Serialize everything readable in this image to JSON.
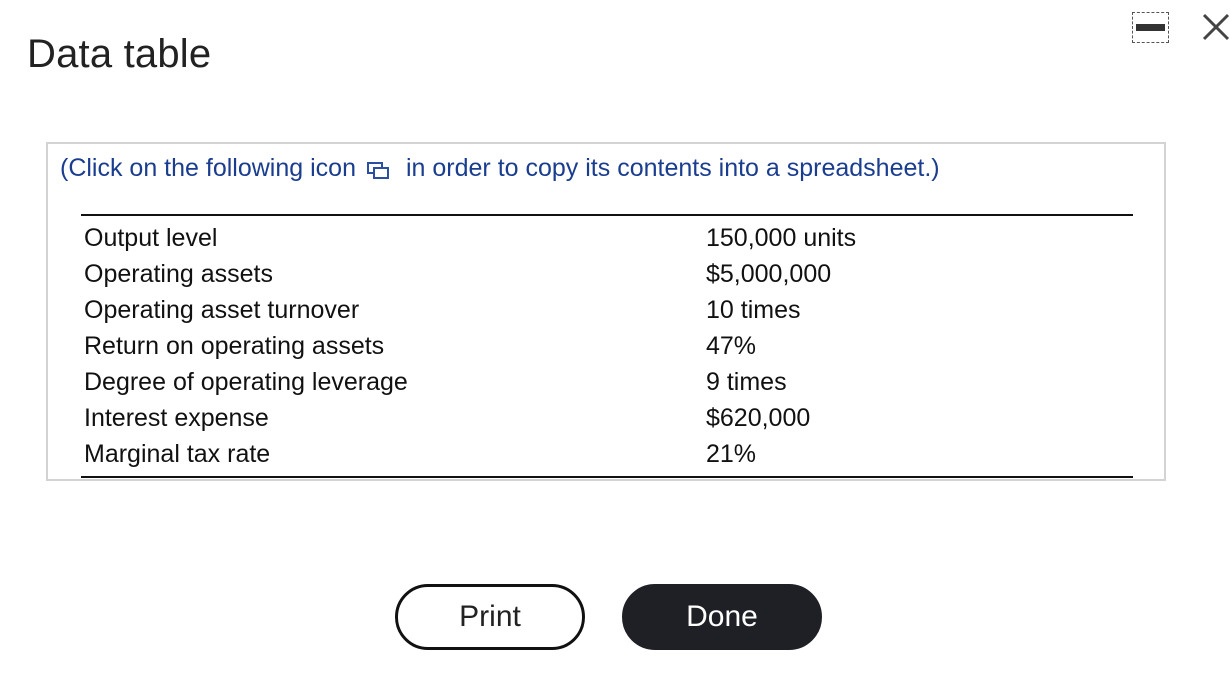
{
  "window": {
    "title": "Data table"
  },
  "panel": {
    "instruction_before": "(Click on the following icon",
    "instruction_after": "in order to copy its contents into a spreadsheet.)"
  },
  "table": {
    "rows": [
      {
        "label": "Output level",
        "value": "150,000 units"
      },
      {
        "label": "Operating assets",
        "value": "$5,000,000"
      },
      {
        "label": "Operating asset turnover",
        "value": "10 times"
      },
      {
        "label": "Return on operating assets",
        "value": "47%"
      },
      {
        "label": "Degree of operating leverage",
        "value": "9 times"
      },
      {
        "label": "Interest expense",
        "value": "$620,000"
      },
      {
        "label": "Marginal tax rate",
        "value": "21%"
      }
    ]
  },
  "buttons": {
    "print_label": "Print",
    "done_label": "Done"
  },
  "icons": {
    "minimize": "minimize-icon",
    "close": "close-icon",
    "copy": "copy-spreadsheet-icon"
  },
  "colors": {
    "instruction_text": "#1a3d8f",
    "done_button_bg": "#1e2025"
  }
}
